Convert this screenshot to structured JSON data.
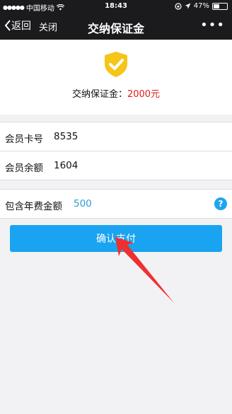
{
  "status_bar": {
    "carrier": "中国移动",
    "time": "18:43",
    "battery": "47%",
    "battery_level": 0.47
  },
  "nav": {
    "back_label": "返回",
    "close_label": "关闭",
    "title": "交纳保证金",
    "more_label": "•••"
  },
  "deposit": {
    "label": "交纳保证金：",
    "amount": "2000元"
  },
  "member": {
    "card_label": "会员卡号",
    "card_value": "8535",
    "balance_label": "会员余额",
    "balance_value": "1604"
  },
  "fee": {
    "label": "包含年费金额",
    "value": "500",
    "help_label": "?"
  },
  "confirm_label": "确认支付",
  "colors": {
    "accent": "#1aa3f0",
    "deposit_amount": "#e01b1b",
    "shield": "#f5c518",
    "annotation_arrow": "#f03030"
  }
}
